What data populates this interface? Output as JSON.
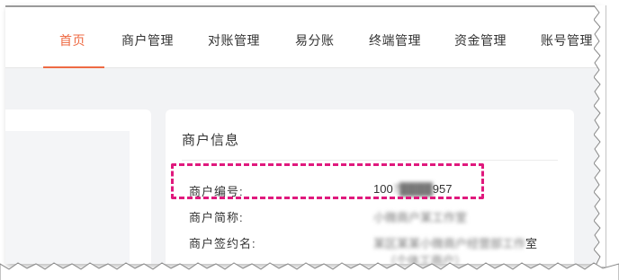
{
  "nav": {
    "tabs": [
      {
        "label": "首页",
        "active": true
      },
      {
        "label": "商户管理",
        "active": false
      },
      {
        "label": "对账管理",
        "active": false
      },
      {
        "label": "易分账",
        "active": false
      },
      {
        "label": "终端管理",
        "active": false
      },
      {
        "label": "资金管理",
        "active": false
      },
      {
        "label": "账号管理",
        "active": false
      }
    ]
  },
  "merchant_info": {
    "title": "商户信息",
    "rows": [
      {
        "label": "商户编号:",
        "value_start": "100",
        "value_hidden": "7████",
        "value_end": "957"
      },
      {
        "label": "商户简称:",
        "value_hidden": "小微商户某工作室"
      },
      {
        "label": "商户签约名:",
        "value_hidden": "某区某某小微商户经营部工作",
        "value_end": "室",
        "value_line2_hidden": "（个体工商户）"
      }
    ]
  },
  "colors": {
    "accent": "#ee6a43",
    "highlight_box": "#e0197d"
  }
}
